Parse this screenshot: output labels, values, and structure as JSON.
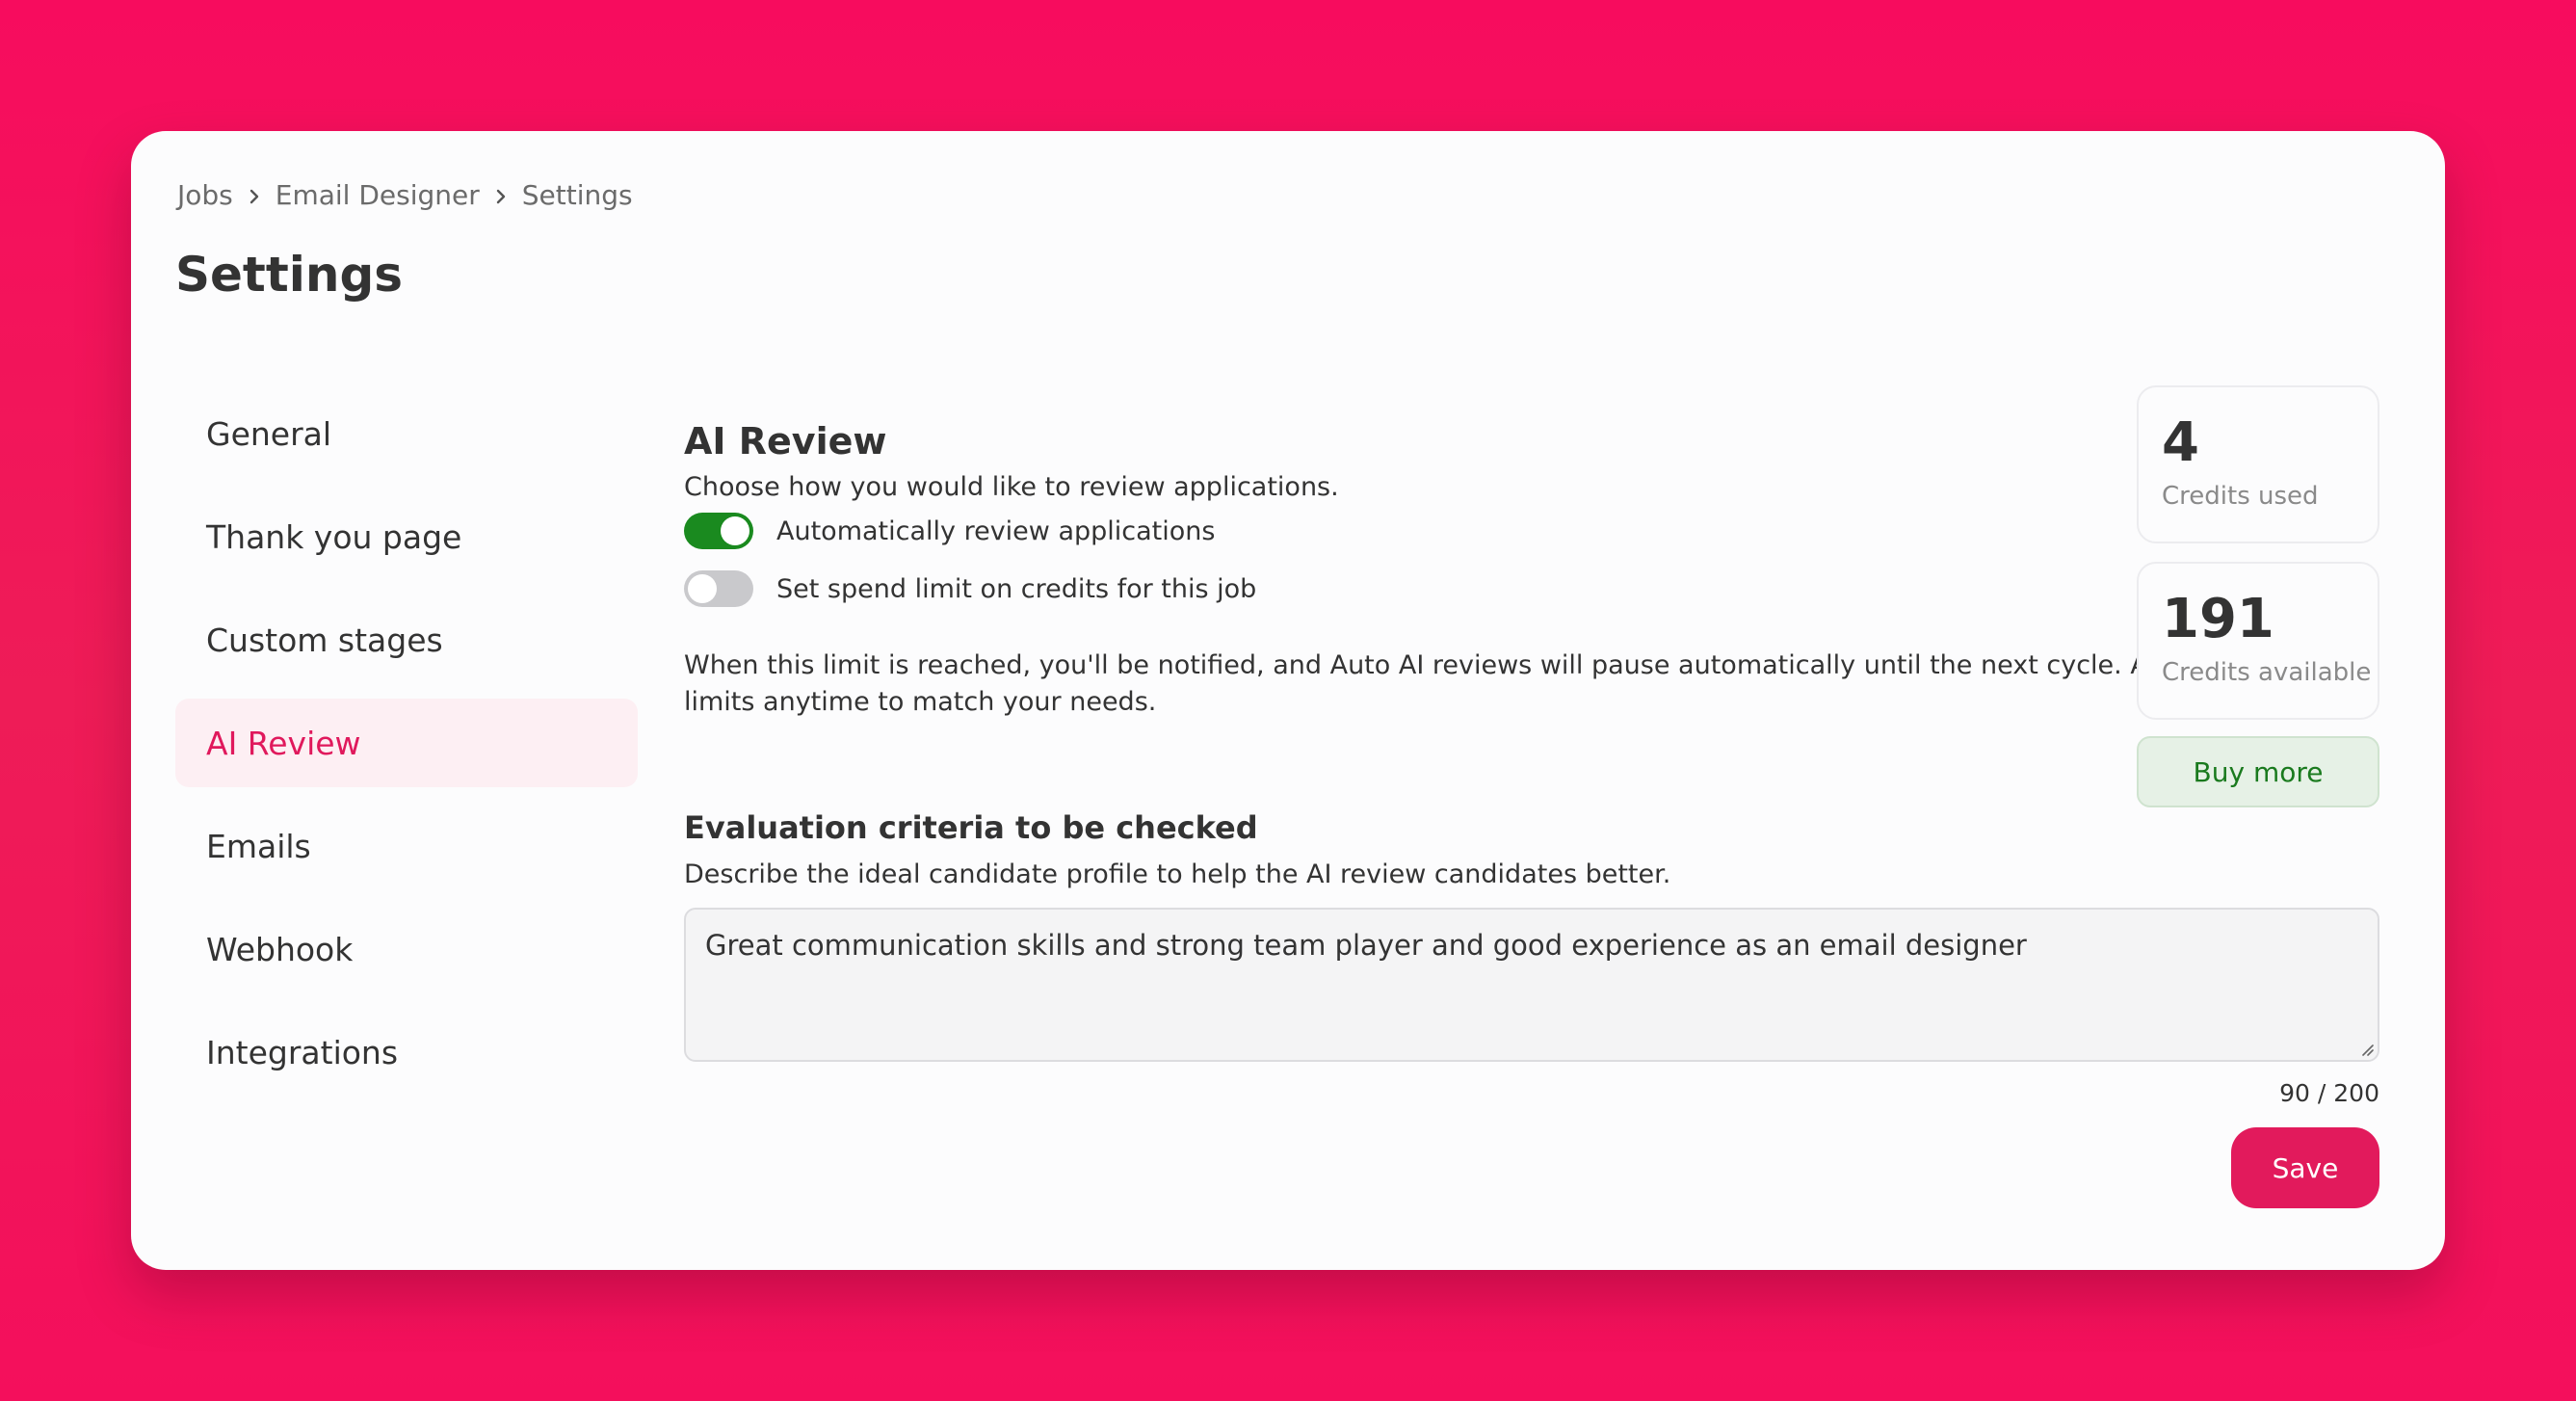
{
  "breadcrumb": {
    "items": [
      "Jobs",
      "Email Designer",
      "Settings"
    ]
  },
  "page": {
    "title": "Settings"
  },
  "sidebar": {
    "items": [
      {
        "label": "General",
        "active": false
      },
      {
        "label": "Thank you page",
        "active": false
      },
      {
        "label": "Custom stages",
        "active": false
      },
      {
        "label": "AI Review",
        "active": true
      },
      {
        "label": "Emails",
        "active": false
      },
      {
        "label": "Webhook",
        "active": false
      },
      {
        "label": "Integrations",
        "active": false
      }
    ]
  },
  "ai_review": {
    "title": "AI Review",
    "description": "Choose how you would like to review applications.",
    "toggles": [
      {
        "label": "Automatically review applications",
        "on": true
      },
      {
        "label": "Set spend limit on credits for this job",
        "on": false
      }
    ],
    "note": "When this limit is reached, you'll be notified, and Auto AI reviews will pause automatically until the next cycle. Adjust limits anytime to match your needs."
  },
  "credits": {
    "used_value": "4",
    "used_label": "Credits used",
    "available_value": "191",
    "available_label": "Credits available",
    "buy_label": "Buy more"
  },
  "criteria": {
    "title": "Evaluation criteria to be checked",
    "description": "Describe the ideal candidate profile to help the AI review candidates better.",
    "value": "Great communication skills and strong team player and good experience as an email designer",
    "char_count": "90 / 200"
  },
  "actions": {
    "save_label": "Save"
  },
  "colors": {
    "background": "#f70c5e",
    "accent": "#e21a5c",
    "toggle_on": "#1a8a1f",
    "toggle_off": "#c9c9cc",
    "buy_text": "#1a7a1e",
    "buy_background": "#e6f1e6"
  },
  "icons": {
    "breadcrumb_separator": "chevron-right-icon",
    "textarea_resize": "resize-handle-icon"
  }
}
